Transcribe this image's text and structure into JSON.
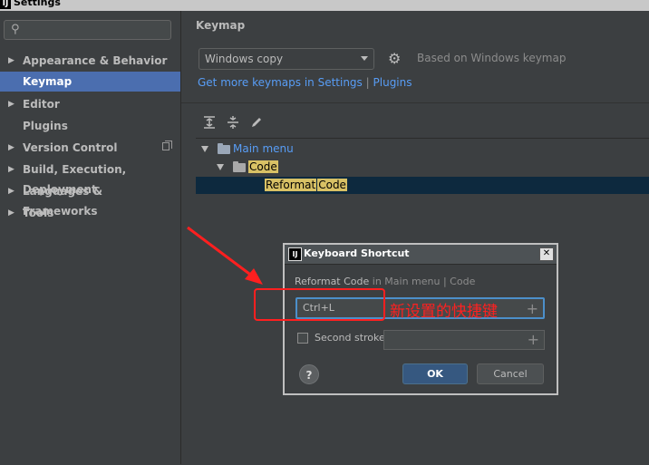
{
  "window": {
    "title": "Settings",
    "app_icon": "intellij-icon"
  },
  "sidebar": {
    "search_placeholder": "",
    "items": [
      {
        "label": "Appearance & Behavior",
        "expandable": true
      },
      {
        "label": "Keymap",
        "expandable": false,
        "selected": true
      },
      {
        "label": "Editor",
        "expandable": true
      },
      {
        "label": "Plugins",
        "expandable": false
      },
      {
        "label": "Version Control",
        "expandable": true
      },
      {
        "label": "Build, Execution, Deployment",
        "expandable": true
      },
      {
        "label": "Languages & Frameworks",
        "expandable": true
      },
      {
        "label": "Tools",
        "expandable": true
      }
    ]
  },
  "main": {
    "title": "Keymap",
    "keymap_select": "Windows copy",
    "based_on": "Based on Windows keymap",
    "link_text": "Get more keymaps in Settings",
    "link_sep": "|",
    "plugins_link": "Plugins",
    "tree": {
      "main_menu": "Main menu",
      "code": "Code",
      "action_part1": "Reformat",
      "action_part2": "Code"
    }
  },
  "dialog": {
    "title": "Keyboard Shortcut",
    "crumb_action": "Reformat Code",
    "crumb_path": "in Main menu | Code",
    "shortcut_value": "Ctrl+L",
    "plus": "+",
    "second_stroke_label": "Second stroke:",
    "help": "?",
    "ok": "OK",
    "cancel": "Cancel"
  },
  "annotation": {
    "text": "新设置的快捷键",
    "color": "#ff2020"
  },
  "colors": {
    "selection": "#4b6eaf",
    "link": "#589df6",
    "highlight": "#d8c165",
    "accent_button": "#365880"
  }
}
